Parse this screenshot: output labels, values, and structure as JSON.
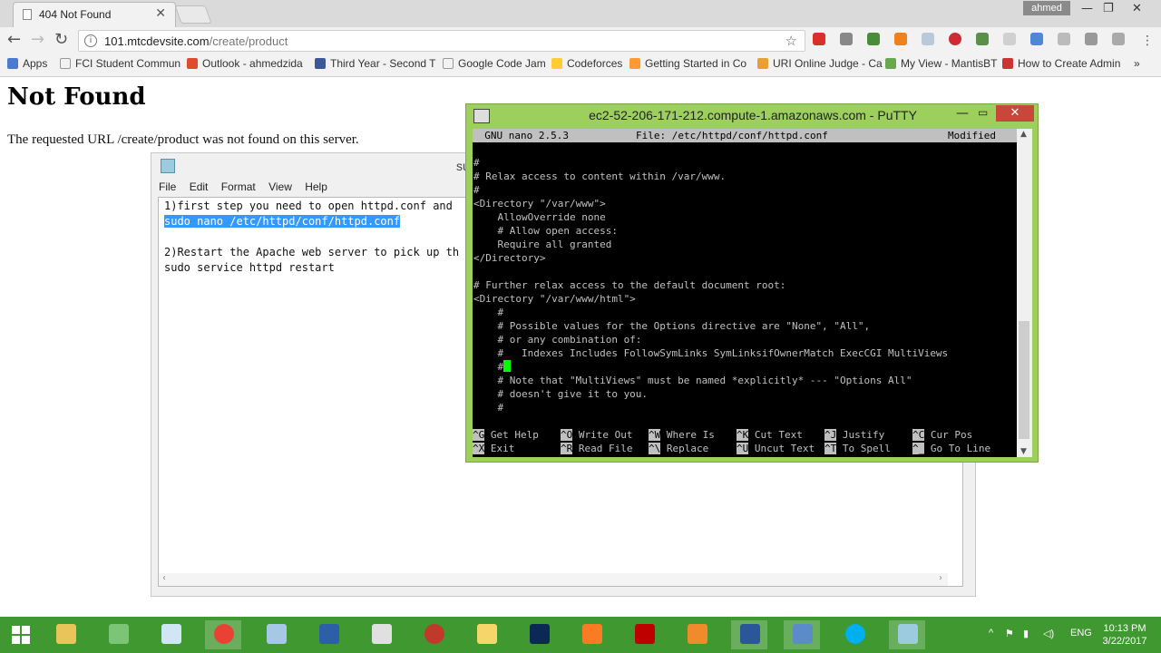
{
  "browser": {
    "tab_title": "404 Not Found",
    "user": "ahmed",
    "url_host": "101.mtcdevsite.com",
    "url_path": "/create/product",
    "bookmarks": [
      {
        "label": "Apps",
        "color": "#4a7bd1"
      },
      {
        "label": "FCI Student Commun",
        "color": "#999999"
      },
      {
        "label": "Outlook - ahmedzida",
        "color": "#e04a2f"
      },
      {
        "label": "Third Year - Second T",
        "color": "#3b5998"
      },
      {
        "label": "Google Code Jam",
        "color": "#ffffff"
      },
      {
        "label": "Codeforces",
        "color": "#ffcc33"
      },
      {
        "label": "Getting Started in Co",
        "color": "#ff9933"
      },
      {
        "label": "URI Online Judge - Ca",
        "color": "#e8a030"
      },
      {
        "label": "My View - MantisBT",
        "color": "#6aa84f"
      },
      {
        "label": "How to Create Admin",
        "color": "#cc3333"
      }
    ],
    "more": "»"
  },
  "page": {
    "title": "Not Found",
    "message": "The requested URL /create/product was not found on this server."
  },
  "notepad": {
    "title": "subdo",
    "menu": [
      "File",
      "Edit",
      "Format",
      "View",
      "Help"
    ],
    "lines": [
      "1)first step you need to open httpd.conf and",
      "sudo nano /etc/httpd/conf/httpd.conf",
      "",
      "2)Restart the Apache web server to pick up th",
      "sudo service httpd restart"
    ]
  },
  "putty": {
    "title": "ec2-52-206-171-212.compute-1.amazonaws.com - PuTTY",
    "status_left": "  GNU nano 2.5.3",
    "status_file": "File: /etc/httpd/conf/httpd.conf",
    "status_right": "Modified",
    "lines": [
      "",
      "#",
      "# Relax access to content within /var/www.",
      "#",
      "<Directory \"/var/www\">",
      "    AllowOverride none",
      "    # Allow open access:",
      "    Require all granted",
      "</Directory>",
      "",
      "# Further relax access to the default document root:",
      "<Directory \"/var/www/html\">",
      "    #",
      "    # Possible values for the Options directive are \"None\", \"All\",",
      "    # or any combination of:",
      "    #   Indexes Includes FollowSymLinks SymLinksifOwnerMatch ExecCGI MultiViews",
      "    #",
      "    # Note that \"MultiViews\" must be named *explicitly* --- \"Options All\"",
      "    # doesn't give it to you.",
      "    #"
    ],
    "shortcuts_row1": [
      {
        "key": "^G",
        "label": "Get Help"
      },
      {
        "key": "^O",
        "label": "Write Out"
      },
      {
        "key": "^W",
        "label": "Where Is"
      },
      {
        "key": "^K",
        "label": "Cut Text"
      },
      {
        "key": "^J",
        "label": "Justify"
      },
      {
        "key": "^C",
        "label": "Cur Pos"
      }
    ],
    "shortcuts_row2": [
      {
        "key": "^X",
        "label": "Exit"
      },
      {
        "key": "^R",
        "label": "Read File"
      },
      {
        "key": "^\\",
        "label": "Replace"
      },
      {
        "key": "^U",
        "label": "Uncut Text"
      },
      {
        "key": "^T",
        "label": "To Spell"
      },
      {
        "key": "^_",
        "label": "Go To Line"
      }
    ]
  },
  "taskbar": {
    "language": "ENG",
    "time": "10:13 PM",
    "date": "3/22/2017",
    "apps": [
      {
        "name": "file-explorer",
        "color": "#e8c45a"
      },
      {
        "name": "android-studio",
        "color": "#7cc576"
      },
      {
        "name": "cube-app",
        "color": "#d0e6f5"
      },
      {
        "name": "chrome",
        "color": "#e94235"
      },
      {
        "name": "virtualbox",
        "color": "#a7c7e7"
      },
      {
        "name": "visual-studio",
        "color": "#2c5fa8"
      },
      {
        "name": "paint",
        "color": "#e0e0e0"
      },
      {
        "name": "recorder",
        "color": "#c0392b"
      },
      {
        "name": "folder-app",
        "color": "#f6d66b"
      },
      {
        "name": "photoshop",
        "color": "#0a2a55"
      },
      {
        "name": "xampp",
        "color": "#fb7a24"
      },
      {
        "name": "filezilla",
        "color": "#bf0000"
      },
      {
        "name": "snipping",
        "color": "#f08a2b"
      },
      {
        "name": "word",
        "color": "#2b579a"
      },
      {
        "name": "putty",
        "color": "#5b8bc9"
      },
      {
        "name": "skype",
        "color": "#00aff0"
      },
      {
        "name": "notepad",
        "color": "#9ccbe0"
      }
    ]
  }
}
